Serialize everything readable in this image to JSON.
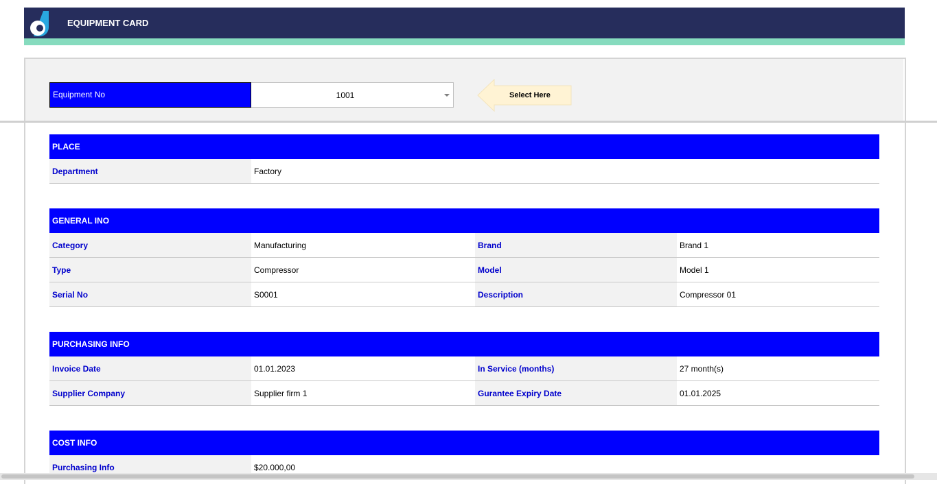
{
  "header": {
    "title": "EQUIPMENT CARD",
    "logo_icon": "brand-logo-icon",
    "colors": {
      "background": "#262d5c",
      "accent": "#86dbbe",
      "section": "#0000ff"
    }
  },
  "selector": {
    "label": "Equipment No",
    "value": "1001",
    "hint": "Select Here",
    "hint_icon": "left-arrow-icon"
  },
  "sections": {
    "place": {
      "title": "PLACE",
      "rows": [
        {
          "label": "Department",
          "value": "Factory"
        }
      ]
    },
    "general": {
      "title": "GENERAL INO",
      "rows": [
        {
          "label": "Category",
          "value": "Manufacturing",
          "label2": "Brand",
          "value2": "Brand 1"
        },
        {
          "label": "Type",
          "value": "Compressor",
          "label2": "Model",
          "value2": "Model 1"
        },
        {
          "label": "Serial No",
          "value": "S0001",
          "label2": "Description",
          "value2": "Compressor 01"
        }
      ]
    },
    "purchasing": {
      "title": "PURCHASING INFO",
      "rows": [
        {
          "label": "Invoice Date",
          "value": "01.01.2023",
          "label2": "In Service (months)",
          "value2": "27 month(s)"
        },
        {
          "label": "Supplier Company",
          "value": "Supplier firm 1",
          "label2": "Gurantee Expiry Date",
          "value2": "01.01.2025"
        }
      ]
    },
    "cost": {
      "title": "COST INFO",
      "rows": [
        {
          "label": "Purchasing Info",
          "value": "$20.000,00"
        }
      ]
    }
  }
}
